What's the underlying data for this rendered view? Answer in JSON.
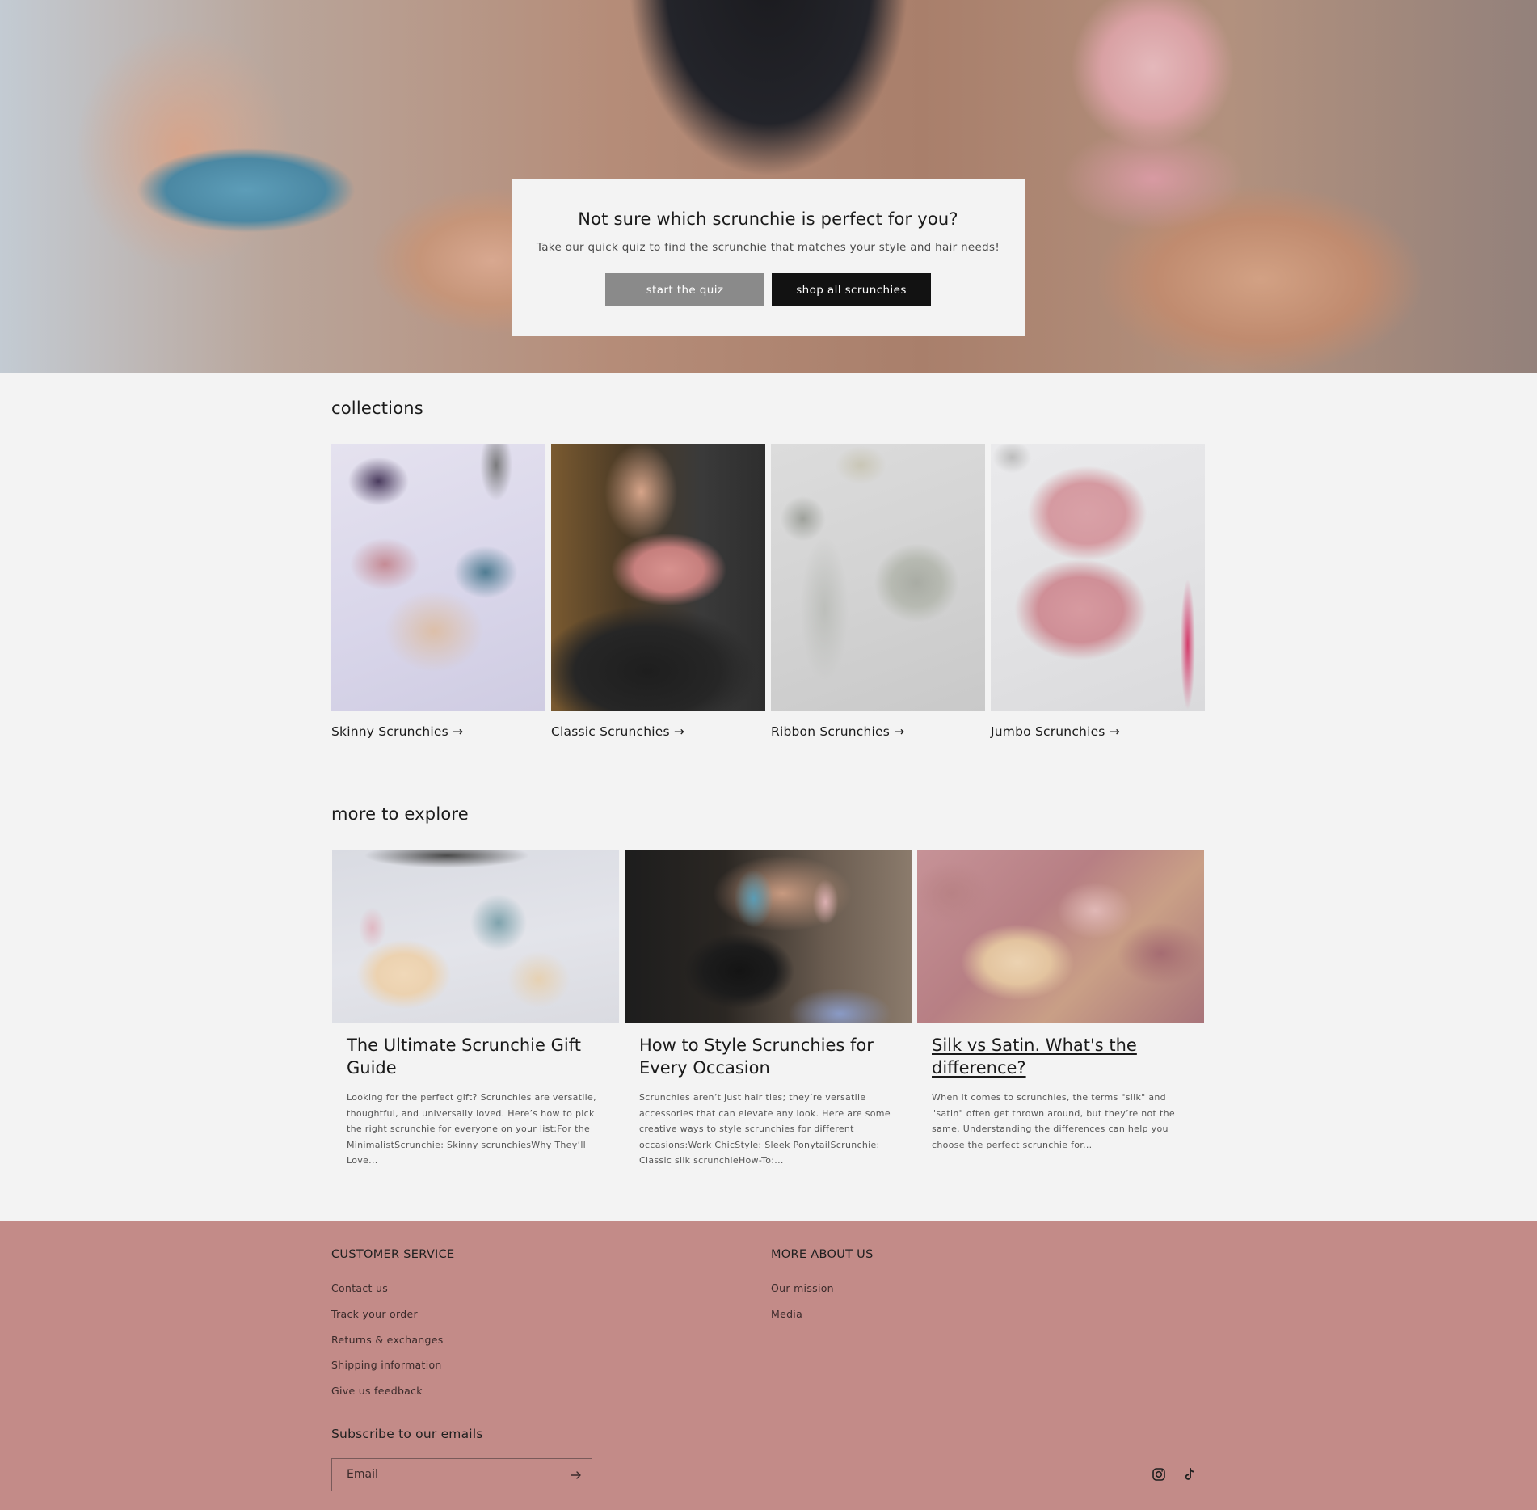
{
  "hero": {
    "quiz_title": "Not sure which scrunchie is perfect for you?",
    "quiz_subtitle": "Take our quick quiz to find the scrunchie that matches your style and hair needs!",
    "start_quiz_label": "start the quiz",
    "shop_all_label": "shop all scrunchies"
  },
  "collections": {
    "heading": "collections",
    "items": [
      {
        "label": "Skinny Scrunchies →"
      },
      {
        "label": "Classic Scrunchies →"
      },
      {
        "label": "Ribbon Scrunchies →"
      },
      {
        "label": "Jumbo Scrunchies →"
      }
    ]
  },
  "explore": {
    "heading": "more to explore",
    "articles": [
      {
        "title": "The Ultimate Scrunchie Gift Guide",
        "excerpt": "Looking for the perfect gift? Scrunchies are versatile, thoughtful, and universally loved. Here’s how to pick the right scrunchie for everyone on your list:For the MinimalistScrunchie: Skinny scrunchiesWhy They’ll Love..."
      },
      {
        "title": "How to Style Scrunchies for Every Occasion",
        "excerpt": "Scrunchies aren’t just hair ties; they’re versatile accessories that can elevate any look. Here are some creative ways to style scrunchies for different occasions:Work ChicStyle: Sleek PonytailScrunchie: Classic silk scrunchieHow-To:..."
      },
      {
        "title": "Silk vs Satin. What's the difference?",
        "excerpt": "When it comes to scrunchies, the terms \"silk\" and \"satin\" often get thrown around, but they’re not the same. Understanding the differences can help you choose the perfect scrunchie for..."
      }
    ]
  },
  "footer": {
    "customer_service": {
      "heading": "CUSTOMER SERVICE",
      "links": [
        "Contact us",
        "Track your order",
        "Returns & exchanges",
        "Shipping information",
        "Give us feedback"
      ]
    },
    "about": {
      "heading": "MORE ABOUT US",
      "links": [
        "Our mission",
        "Media"
      ]
    },
    "subscribe": {
      "heading": "Subscribe to our emails",
      "email_placeholder": "Email"
    },
    "social": [
      "instagram-icon",
      "tiktok-icon"
    ]
  },
  "colors": {
    "page_bg": "#f3f3f3",
    "footer_bg": "#c38b88",
    "quiz_button_bg": "#8a8a8a",
    "shop_button_bg": "#121212"
  }
}
